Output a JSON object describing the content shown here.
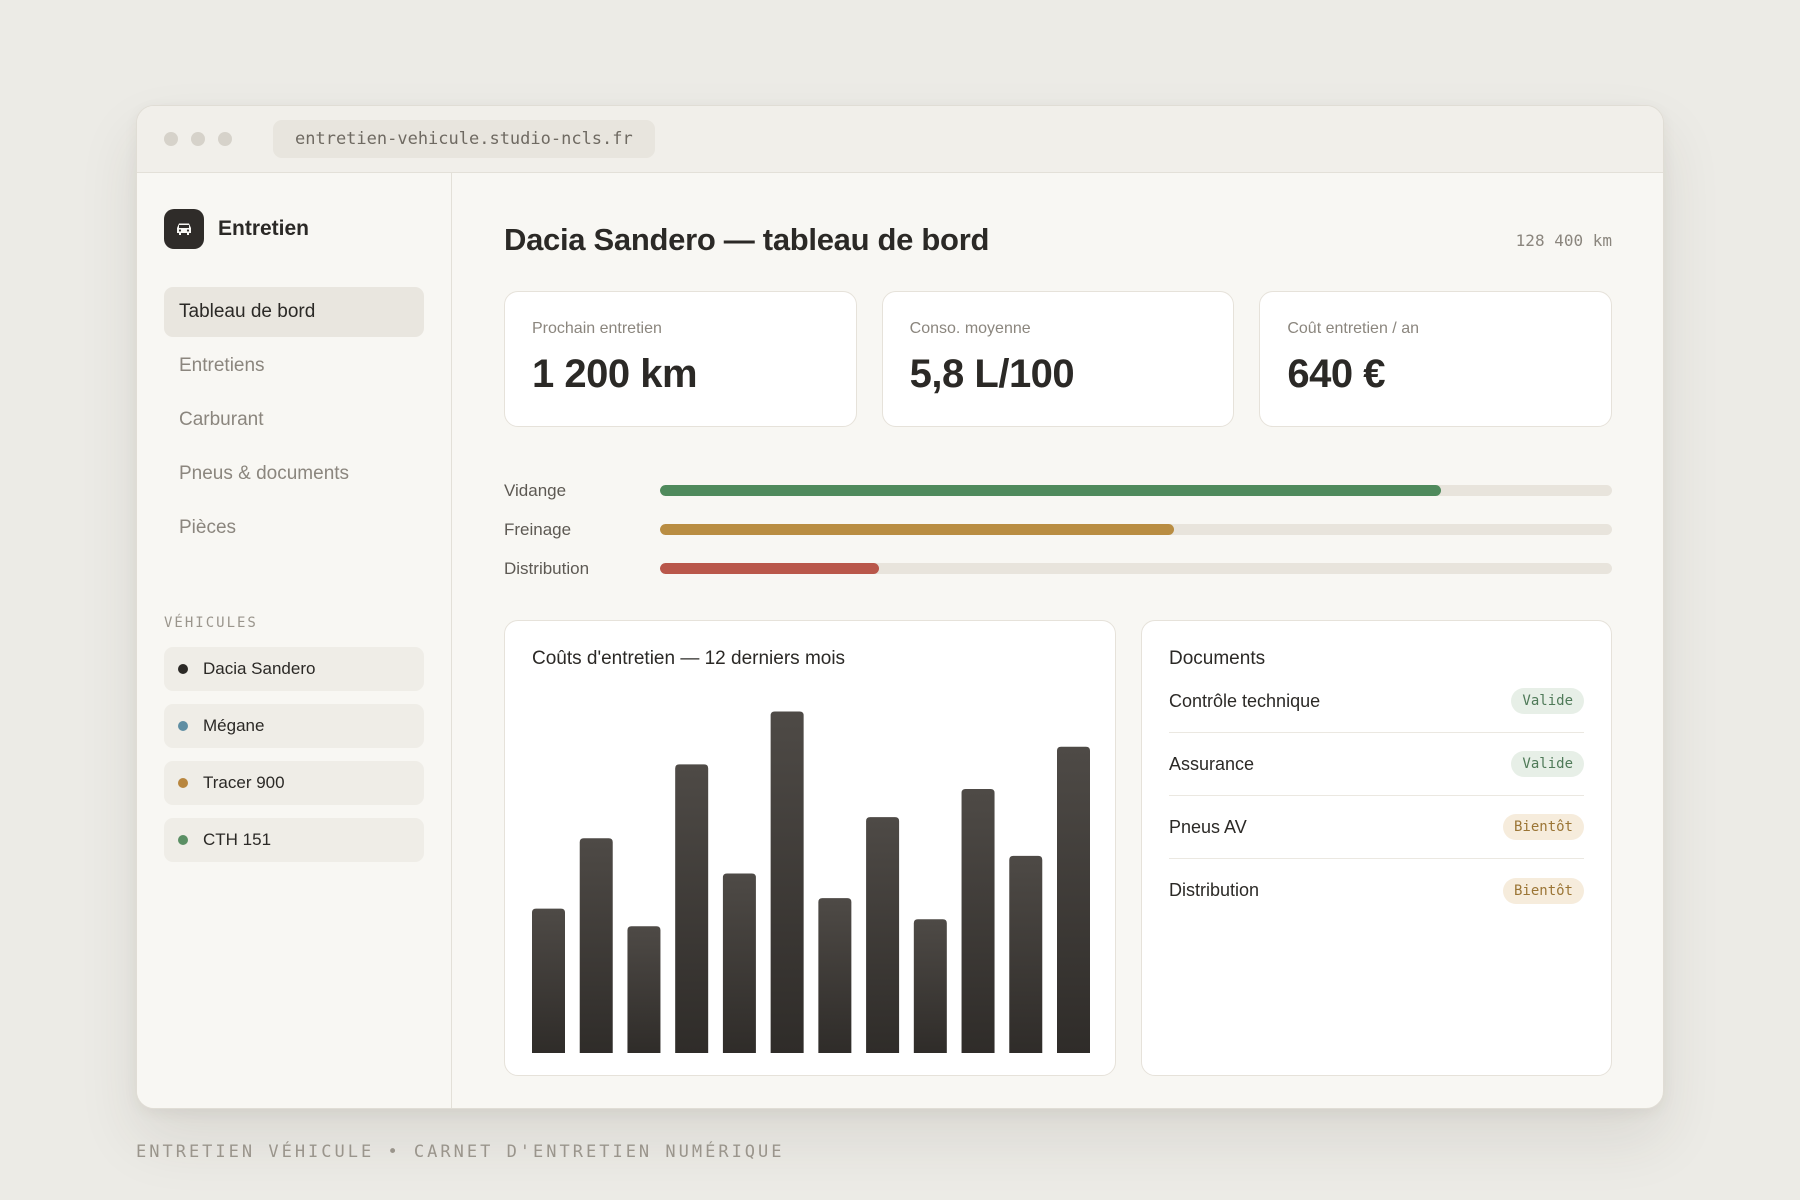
{
  "browser": {
    "url": "entretien-vehicule.studio-ncls.fr"
  },
  "sidebar": {
    "brand": "Entretien",
    "nav": [
      {
        "label": "Tableau de bord",
        "active": true
      },
      {
        "label": "Entretiens",
        "active": false
      },
      {
        "label": "Carburant",
        "active": false
      },
      {
        "label": "Pneus & documents",
        "active": false
      },
      {
        "label": "Pièces",
        "active": false
      }
    ],
    "vehicles_label": "VÉHICULES",
    "vehicles": [
      {
        "label": "Dacia Sandero",
        "color": "#2b2926"
      },
      {
        "label": "Mégane",
        "color": "#5f8ea3"
      },
      {
        "label": "Tracer 900",
        "color": "#b8863e"
      },
      {
        "label": "CTH 151",
        "color": "#5a8f64"
      }
    ]
  },
  "header": {
    "title": "Dacia Sandero — tableau de bord",
    "odometer": "128 400 km"
  },
  "kpis": [
    {
      "label": "Prochain entretien",
      "value": "1 200 km"
    },
    {
      "label": "Conso. moyenne",
      "value": "5,8 L/100"
    },
    {
      "label": "Coût entretien / an",
      "value": "640 €"
    }
  ],
  "wear": [
    {
      "label": "Vidange",
      "level": 0.82,
      "color": "#4f8a5c"
    },
    {
      "label": "Freinage",
      "level": 0.54,
      "color": "#b98d42"
    },
    {
      "label": "Distribution",
      "level": 0.23,
      "color": "#b9574a"
    }
  ],
  "chart_data": {
    "type": "bar",
    "title": "Coûts d'entretien — 12 derniers mois",
    "values": [
      41,
      61,
      36,
      82,
      51,
      97,
      44,
      67,
      38,
      75,
      56,
      87
    ],
    "ylim": [
      0,
      100
    ]
  },
  "documents": {
    "title": "Documents",
    "items": [
      {
        "label": "Contrôle technique",
        "status": "Valide",
        "kind": "ok"
      },
      {
        "label": "Assurance",
        "status": "Valide",
        "kind": "ok"
      },
      {
        "label": "Pneus AV",
        "status": "Bientôt",
        "kind": "soon"
      },
      {
        "label": "Distribution",
        "status": "Bientôt",
        "kind": "soon"
      }
    ]
  },
  "footer": "ENTRETIEN VÉHICULE • CARNET D'ENTRETIEN NUMÉRIQUE"
}
